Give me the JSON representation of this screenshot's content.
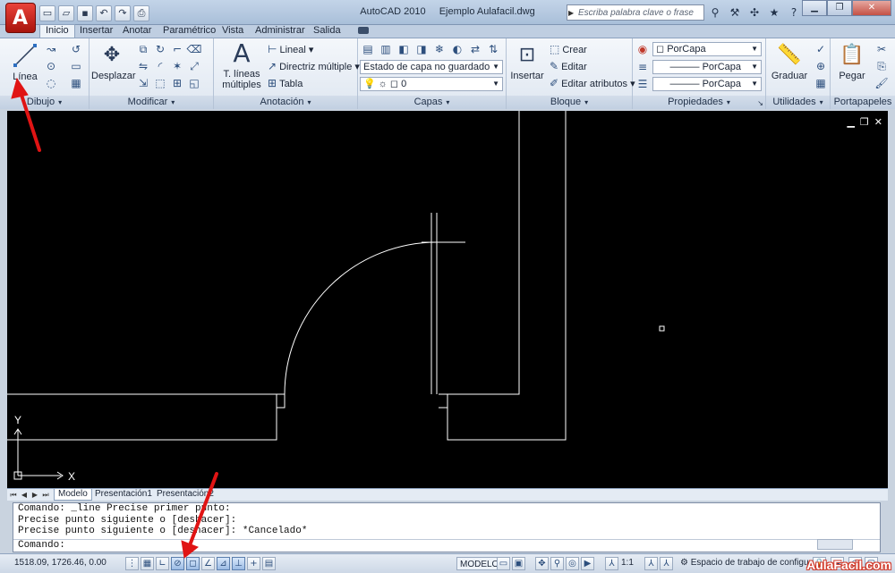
{
  "titlebar": {
    "app_name": "AutoCAD 2010",
    "file_name": "Ejemplo Aulafacil.dwg",
    "search_placeholder": "Escriba palabra clave o frase"
  },
  "tabs": [
    "Inicio",
    "Insertar",
    "Anotar",
    "Paramétrico",
    "Vista",
    "Administrar",
    "Salida"
  ],
  "ribbon": {
    "dibujo": {
      "title": "Dibujo",
      "linea": "Línea"
    },
    "modificar": {
      "title": "Modificar",
      "desplazar": "Desplazar"
    },
    "anotacion": {
      "title": "Anotación",
      "t_lineas_1": "T. líneas",
      "t_lineas_2": "múltiples",
      "lineal": "Lineal",
      "directriz": "Directriz múltiple",
      "tabla": "Tabla"
    },
    "capas": {
      "title": "Capas",
      "estado": "Estado de capa no guardado",
      "capa_actual": "0"
    },
    "bloque": {
      "title": "Bloque",
      "insertar": "Insertar",
      "crear": "Crear",
      "editar": "Editar",
      "editar_atributos": "Editar atributos"
    },
    "propiedades": {
      "title": "Propiedades",
      "color": "PorCapa",
      "tipo_linea": "PorCapa",
      "grosor": "PorCapa"
    },
    "utilidades": {
      "title": "Utilidades",
      "graduar": "Graduar"
    },
    "portapapeles": {
      "title": "Portapapeles",
      "pegar": "Pegar"
    }
  },
  "ucs": {
    "x": "X",
    "y": "Y"
  },
  "layout_tabs": [
    "Modelo",
    "Presentación1",
    "Presentación2"
  ],
  "command": {
    "lines": [
      "Comando: _line Precise primer punto:",
      "Precise punto siguiente o [deshacer]:",
      "Precise punto siguiente o [deshacer]: *Cancelado*"
    ],
    "prompt": "Comando:"
  },
  "status": {
    "coords": "1518.09, 1726.46, 0.00",
    "model": "MODELO",
    "scale": "1:1",
    "workspace": "Espacio de trabajo de configura"
  },
  "watermark": "AulaFacil.com",
  "colors": {
    "canvas": "#000000",
    "lines": "#ffffff",
    "arrows": "#e01414"
  }
}
